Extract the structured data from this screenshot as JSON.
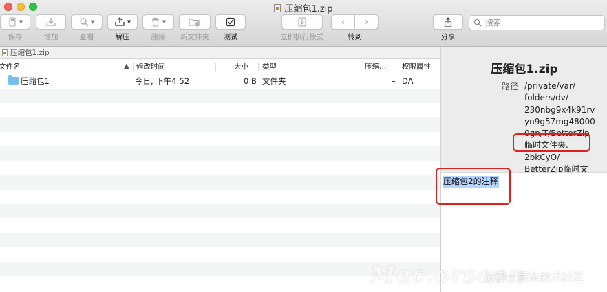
{
  "window": {
    "title": "压缩包1.zip"
  },
  "toolbar": {
    "items": [
      {
        "label": "保存",
        "icon": "save-icon",
        "enabled": false
      },
      {
        "label": "增加",
        "icon": "add-icon",
        "enabled": false
      },
      {
        "label": "查看",
        "icon": "view-icon",
        "enabled": false
      },
      {
        "label": "解压",
        "icon": "extract-icon",
        "enabled": true
      },
      {
        "label": "删除",
        "icon": "trash-icon",
        "enabled": false
      },
      {
        "label": "新文件夹",
        "icon": "new-folder-icon",
        "enabled": false
      },
      {
        "label": "测试",
        "icon": "checkbox-icon",
        "enabled": true
      },
      {
        "label": "立即执行模式",
        "icon": "run-icon",
        "enabled": false
      },
      {
        "label": "转到",
        "icon": "chevron-icon",
        "enabled": true
      },
      {
        "label": "分享",
        "icon": "share-icon",
        "enabled": true
      }
    ],
    "search_placeholder": "搜索"
  },
  "pathbar": {
    "label": "压缩包1.zip"
  },
  "columns": {
    "name": "文件名",
    "modified": "修改时间",
    "size": "大小",
    "kind": "类型",
    "compressed": "压缩…",
    "permissions": "权限属性"
  },
  "rows": [
    {
      "name": "压缩包1",
      "modified": "今日, 下午4:52",
      "size": "0 B",
      "kind": "文件夹",
      "compressed": "–",
      "permissions": "DA"
    }
  ],
  "inspector": {
    "title": "压缩包1.zip",
    "path_label": "路径",
    "path_lines": [
      "/private/var/",
      "folders/dv/",
      "230nbg9x4k91rv",
      "yn9g57mg48000",
      "0gn/T/BetterZip",
      "临时文件夹.",
      "2bkCyO/",
      "BetterZip临时文"
    ]
  },
  "comment": {
    "text": "压缩包2的注释"
  },
  "watermark": {
    "brand": "Mac.orsoon",
    "credit": "@稀土掘金技术社区"
  },
  "colors": {
    "highlight": "#e0201c",
    "selection": "#b4d5fe",
    "folder": "#76bdf0"
  }
}
